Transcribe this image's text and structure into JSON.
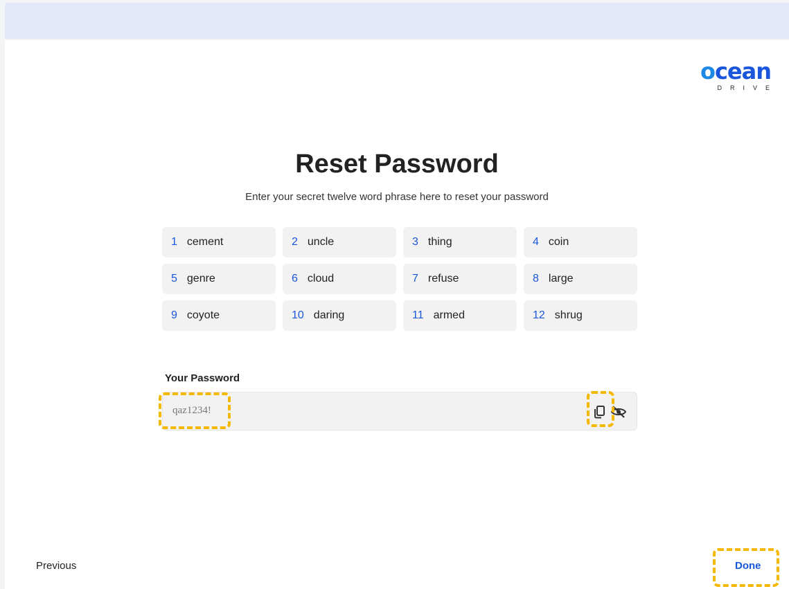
{
  "header": {
    "bar_color": "#e3e8f8"
  },
  "logo": {
    "main_prefix": "o",
    "main_rest": "cean",
    "sub": "DRIVE"
  },
  "title": "Reset Password",
  "subtitle": "Enter your secret twelve word phrase here to reset your password",
  "words": [
    {
      "num": "1",
      "word": "cement"
    },
    {
      "num": "2",
      "word": "uncle"
    },
    {
      "num": "3",
      "word": "thing"
    },
    {
      "num": "4",
      "word": "coin"
    },
    {
      "num": "5",
      "word": "genre"
    },
    {
      "num": "6",
      "word": "cloud"
    },
    {
      "num": "7",
      "word": "refuse"
    },
    {
      "num": "8",
      "word": "large"
    },
    {
      "num": "9",
      "word": "coyote"
    },
    {
      "num": "10",
      "word": "daring"
    },
    {
      "num": "11",
      "word": "armed"
    },
    {
      "num": "12",
      "word": "shrug"
    }
  ],
  "password": {
    "label": "Your Password",
    "value": "qaz1234!",
    "copy_icon": "copy-icon",
    "visibility_icon": "eye-off-icon"
  },
  "nav": {
    "previous": "Previous",
    "done": "Done"
  },
  "colors": {
    "accent": "#1a56db",
    "highlight": "#f5b800"
  }
}
